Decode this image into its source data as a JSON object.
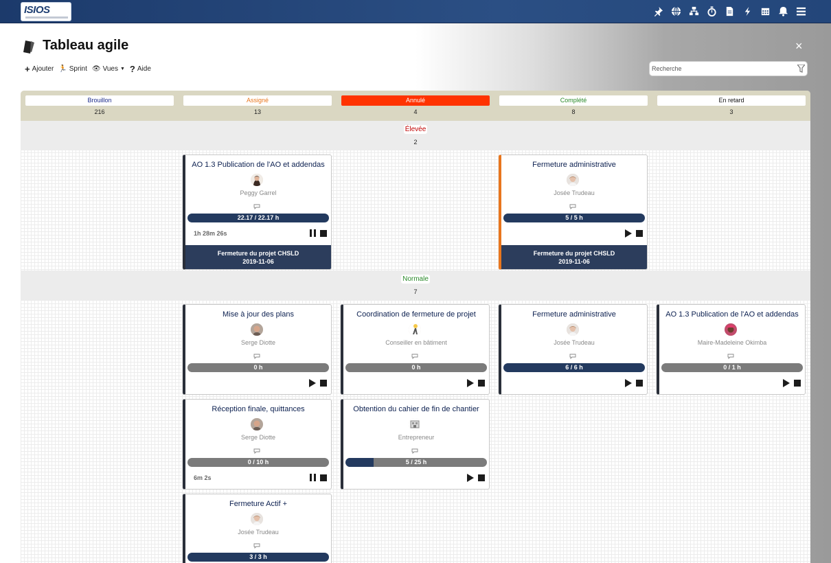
{
  "app": {
    "logo_text": "ISIOS"
  },
  "page": {
    "title": "Tableau agile",
    "close_label": "×"
  },
  "toolbar": {
    "add": "Ajouter",
    "sprint": "Sprint",
    "views": "Vues",
    "help": "Aide",
    "add_icon": "plus-icon",
    "sprint_icon": "runner-icon",
    "views_icon": "eye-icon",
    "help_icon": "question-icon"
  },
  "search": {
    "placeholder": "Recherche"
  },
  "topbar_icons": [
    "pin-icon",
    "globe-icon",
    "sitemap-icon",
    "stopwatch-icon",
    "document-icon",
    "bolt-icon",
    "calendar-icon",
    "bell-icon",
    "menu-icon"
  ],
  "columns": [
    {
      "label": "Brouillon",
      "count": "216",
      "color": "#1a2a8a"
    },
    {
      "label": "Assigné",
      "count": "13",
      "color": "#e8761e"
    },
    {
      "label": "Annulé",
      "count": "4",
      "color": "#ff3300"
    },
    {
      "label": "Complété",
      "count": "8",
      "color": "#2a8a2a"
    },
    {
      "label": "En retard",
      "count": "3",
      "color": "#111111"
    }
  ],
  "lanes": [
    {
      "label": "Élevée",
      "count": "2",
      "color": "#c00000"
    },
    {
      "label": "Normale",
      "count": "7",
      "color": "#2a8a2a"
    }
  ],
  "cards": [
    {
      "title": "AO 1.3 Publication de l'AO et addendas",
      "person": "Peggy Garrel",
      "progress": "22.17 / 22.17 h",
      "fill": 1.0,
      "timer": "1h 28m 26s",
      "state": "paused",
      "footer_title": "Fermeture du projet CHSLD",
      "footer_date": "2019-11-06"
    },
    {
      "title": "Fermeture administrative",
      "person": "Josée Trudeau",
      "progress": "5 / 5 h",
      "fill": 1.0,
      "timer": "",
      "state": "stopped",
      "footer_title": "Fermeture du projet CHSLD",
      "footer_date": "2019-11-06"
    },
    {
      "title": "Mise à jour des plans",
      "person": "Serge Diotte",
      "progress": "0 h",
      "fill": 0,
      "timer": "",
      "state": "stopped"
    },
    {
      "title": "Coordination de fermeture de projet",
      "person": "Conseiller en bâtiment",
      "progress": "0 h",
      "fill": 0,
      "timer": "",
      "state": "stopped"
    },
    {
      "title": "Fermeture administrative",
      "person": "Josée Trudeau",
      "progress": "6 / 6 h",
      "fill": 1.0,
      "timer": "",
      "state": "stopped"
    },
    {
      "title": "AO 1.3 Publication de l'AO et addendas",
      "person": "Maire-Madeleine Okimba",
      "progress": "0 / 1 h",
      "fill": 0,
      "timer": "",
      "state": "stopped"
    },
    {
      "title": "Réception finale, quittances",
      "person": "Serge Diotte",
      "progress": "0 / 10 h",
      "fill": 0,
      "timer": "6m 2s",
      "state": "paused"
    },
    {
      "title": "Obtention du cahier de fin de chantier",
      "person": "Entrepreneur",
      "progress": "5 / 25 h",
      "fill": 0.2,
      "timer": "",
      "state": "stopped"
    },
    {
      "title": "Fermeture Actif +",
      "person": "Josée Trudeau",
      "progress": "3 / 3 h",
      "fill": 1.0,
      "timer": "",
      "state": "stopped"
    }
  ]
}
